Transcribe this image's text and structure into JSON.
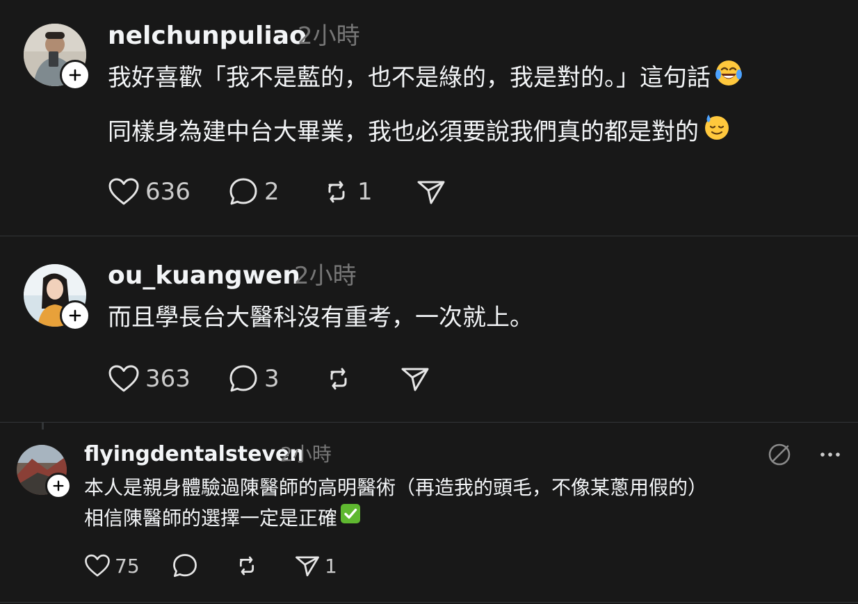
{
  "colors": {
    "background": "#181818",
    "text_primary": "#f3f5f7",
    "text_secondary": "#777777",
    "divider": "#333638",
    "check_green": "#5fb830"
  },
  "posts": [
    {
      "username": "nelchunpuliao",
      "time": "2小時",
      "lines": [
        "我好喜歡「我不是藍的，也不是綠的，我是對的。」這句話",
        "同樣身為建中台大畢業，我也必須要說我們真的都是對的"
      ],
      "emojis": [
        "laughing-tears-emoji",
        "sweat-smile-emoji"
      ],
      "likes": "636",
      "replies": "2",
      "reposts": "1"
    },
    {
      "username": "ou_kuangwen",
      "time": "2小時",
      "lines": [
        "而且學長台大醫科沒有重考，一次就上。"
      ],
      "likes": "363",
      "replies": "3"
    },
    {
      "username": "flyingdentalsteven",
      "time": "2小時",
      "lines": [
        "本人是親身體驗過陳醫師的高明醫術（再造我的頭毛，不像某蔥用假的）",
        "相信陳醫師的選擇一定是正確"
      ],
      "emojis": [
        "check-mark-emoji"
      ],
      "likes": "75",
      "shares": "1"
    }
  ]
}
